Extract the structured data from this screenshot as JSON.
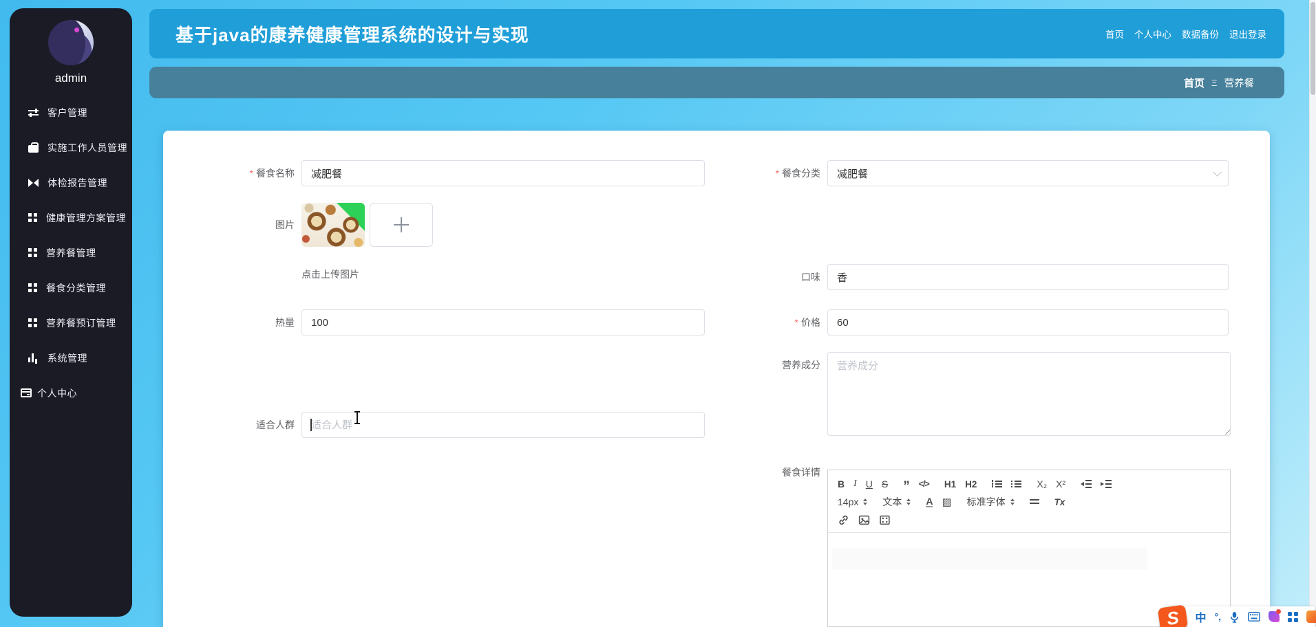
{
  "colors": {
    "page_bg": "#56c8f4",
    "header_bg": "#1f9ed8",
    "breadcrumb_bg": "#47809b",
    "sidebar_bg": "#1a1b25",
    "required_mark": "#f56c6c",
    "ime_blue": "#1b6ec2",
    "ime_orange": "#f4581c"
  },
  "header": {
    "title": "基于java的康养健康管理系统的设计与实现",
    "nav": [
      "首页",
      "个人中心",
      "数据备份",
      "退出登录"
    ]
  },
  "breadcrumb": {
    "home": "首页",
    "separator": "Ξ",
    "current": "营养餐"
  },
  "sidebar": {
    "username": "admin",
    "items": [
      {
        "name": "sidebar-item-customer-management",
        "icon": "sliders-icon",
        "cls": "ic-sliders",
        "label": "客户管理"
      },
      {
        "name": "sidebar-item-staff-management",
        "icon": "briefcase-icon",
        "cls": "ic-case",
        "label": "实施工作人员管理"
      },
      {
        "name": "sidebar-item-checkup-report-management",
        "icon": "report-icon",
        "cls": "ic-bowtie",
        "label": "体检报告管理"
      },
      {
        "name": "sidebar-item-health-plan-management",
        "icon": "grid-icon",
        "cls": "ic-grid",
        "label": "健康管理方案管理"
      },
      {
        "name": "sidebar-item-nutrition-meal-management",
        "icon": "grid-icon",
        "cls": "ic-grid",
        "label": "营养餐管理"
      },
      {
        "name": "sidebar-item-meal-category-management",
        "icon": "grid-icon",
        "cls": "ic-grid",
        "label": "餐食分类管理"
      },
      {
        "name": "sidebar-item-meal-booking-management",
        "icon": "grid-icon",
        "cls": "ic-grid",
        "label": "营养餐预订管理"
      },
      {
        "name": "sidebar-item-system-management",
        "icon": "bar-chart-icon",
        "cls": "ic-chart",
        "label": "系统管理"
      },
      {
        "name": "sidebar-item-personal-center",
        "icon": "card-icon",
        "cls": "ic-card",
        "label": "个人中心",
        "item_cls": "sitem-last"
      }
    ]
  },
  "form": {
    "meal_name": {
      "label": "餐食名称",
      "required": "*",
      "value": "减肥餐"
    },
    "meal_category": {
      "label": "餐食分类",
      "required": "*",
      "value": "减肥餐"
    },
    "image": {
      "label": "图片",
      "hint": "点击上传图片"
    },
    "taste": {
      "label": "口味",
      "value": "香"
    },
    "calories": {
      "label": "热量",
      "value": "100"
    },
    "price": {
      "label": "价格",
      "required": "*",
      "value": "60"
    },
    "nutrition": {
      "label": "营养成分",
      "placeholder": "营养成分"
    },
    "suitable": {
      "label": "适合人群",
      "placeholder": "适合人群"
    },
    "detail": {
      "label": "餐食详情"
    }
  },
  "editor": {
    "font_size": "14px",
    "text_type": "文本",
    "font_family": "标准字体",
    "tools": {
      "bold": "B",
      "italic": "I",
      "underline": "U",
      "strike": "S",
      "quote": "”",
      "code": "</>",
      "h1": "H1",
      "h2": "H2",
      "sub": "X₂",
      "sup": "X²",
      "fontcolor": "A",
      "highlight": "▨",
      "clear": "Tx"
    },
    "icon_names": [
      "ordered-list-icon",
      "unordered-list-icon",
      "outdent-icon",
      "indent-icon",
      "line-height-icon",
      "link-icon",
      "image-icon",
      "video-icon"
    ]
  },
  "ime": {
    "lang": "中",
    "punct": "°,"
  }
}
